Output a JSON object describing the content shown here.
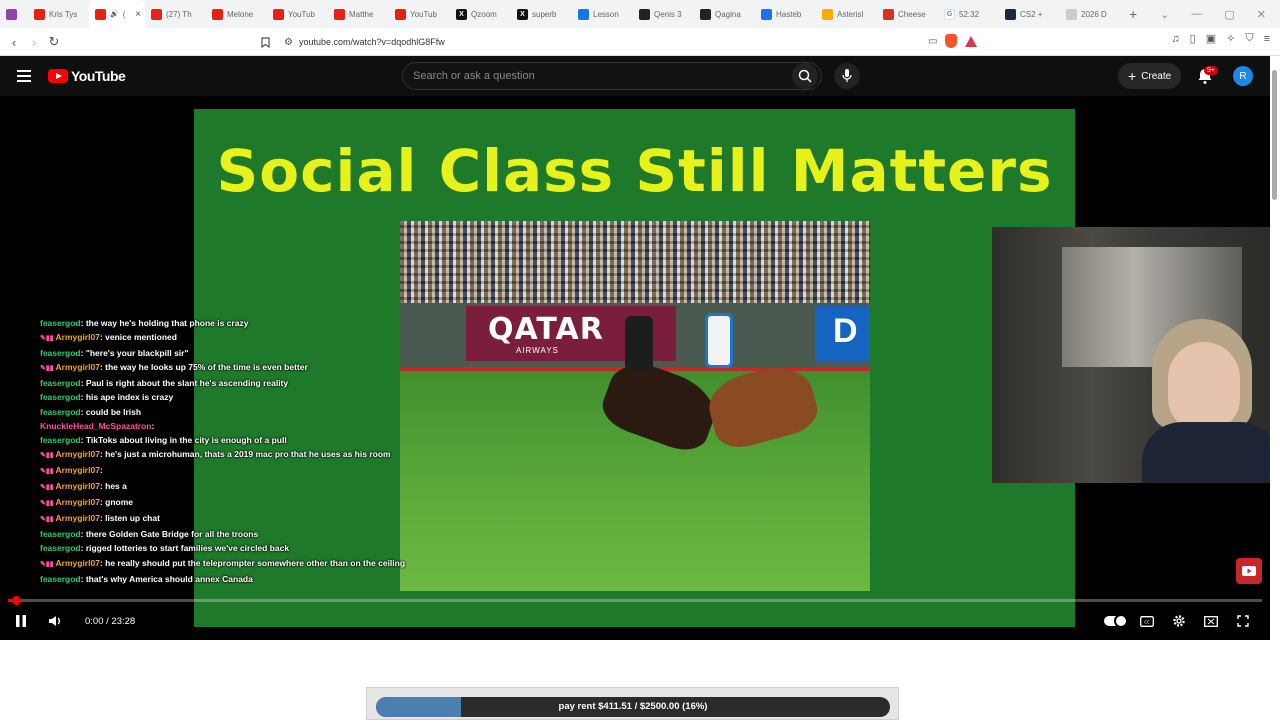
{
  "browser": {
    "tabs": [
      {
        "title": "Kris Tys",
        "icon": "yt"
      },
      {
        "title": "(",
        "icon": "yt",
        "active": true
      },
      {
        "title": "(27) Th",
        "icon": "yt"
      },
      {
        "title": "Melone",
        "icon": "yt"
      },
      {
        "title": "YouTub",
        "icon": "yt"
      },
      {
        "title": "Matthe",
        "icon": "yt"
      },
      {
        "title": "YouTub",
        "icon": "yt"
      },
      {
        "title": "Qzoom",
        "icon": "x"
      },
      {
        "title": "superb",
        "icon": "x"
      },
      {
        "title": "Lesson",
        "icon": "doc"
      },
      {
        "title": "Qenis 3",
        "icon": "quora"
      },
      {
        "title": "Qagina",
        "icon": "quora"
      },
      {
        "title": "Hasteb",
        "icon": "doc"
      },
      {
        "title": "Asterisl",
        "icon": "star"
      },
      {
        "title": "Cheese",
        "icon": "cheese"
      },
      {
        "title": "52:32",
        "icon": "g"
      },
      {
        "title": "CS2 +",
        "icon": "steam"
      },
      {
        "title": "2026 D",
        "icon": "grey"
      }
    ],
    "url": "youtube.com/watch?v=dqodhlG8Ffw"
  },
  "youtube": {
    "logo_text": "YouTube",
    "search_placeholder": "Search or ask a question",
    "create_label": "Create",
    "notif_badge": "9+",
    "avatar_letter": "R"
  },
  "slide": {
    "title": "Social Class Still Matters",
    "qatar_text": "QATAR",
    "qatar_sub": "AIRWAYS",
    "dx_text": "D"
  },
  "chat": [
    {
      "user": "feasergod",
      "color": "green",
      "badges": false,
      "text": ": the way he's holding that phone is crazy"
    },
    {
      "user": "Armygirl07",
      "color": "orange",
      "badges": true,
      "text": ": venice mentioned"
    },
    {
      "user": "feasergod",
      "color": "green",
      "badges": false,
      "text": ": \"here's your blackpill sir\""
    },
    {
      "user": "Armygirl07",
      "color": "orange",
      "badges": true,
      "text": ": the way he looks up 75% of the time is even better"
    },
    {
      "user": "feasergod",
      "color": "green",
      "badges": false,
      "text": ": Paul is right about the slant he's ascending reality"
    },
    {
      "user": "feasergod",
      "color": "green",
      "badges": false,
      "text": ": his ape index is crazy"
    },
    {
      "user": "feasergod",
      "color": "green",
      "badges": false,
      "text": ": could be Irish"
    },
    {
      "user": "KnuckleHead_McSpazatron",
      "color": "pink",
      "badges": false,
      "text": ":"
    },
    {
      "user": "feasergod",
      "color": "green",
      "badges": false,
      "text": ": TikToks about living in the city is enough of a pull"
    },
    {
      "user": "Armygirl07",
      "color": "orange",
      "badges": true,
      "text": ": he's just a microhuman, thats a 2019 mac pro that he uses as his room"
    },
    {
      "user": "Armygirl07",
      "color": "orange",
      "badges": true,
      "text": ":"
    },
    {
      "user": "Armygirl07",
      "color": "orange",
      "badges": true,
      "text": ": hes a"
    },
    {
      "user": "Armygirl07",
      "color": "orange",
      "badges": true,
      "text": ": gnome"
    },
    {
      "user": "Armygirl07",
      "color": "orange",
      "badges": true,
      "text": ": listen up chat"
    },
    {
      "user": "feasergod",
      "color": "green",
      "badges": false,
      "text": ": there Golden Gate Bridge for all the troons"
    },
    {
      "user": "feasergod",
      "color": "green",
      "badges": false,
      "text": ": rigged lotteries to start families we've circled back"
    },
    {
      "user": "Armygirl07",
      "color": "orange",
      "badges": true,
      "text": ": he really should put the teleprompter somewhere other than on the ceiling"
    },
    {
      "user": "feasergod",
      "color": "green",
      "badges": false,
      "text": ": that's why America should annex Canada"
    }
  ],
  "player": {
    "time": "0:00 / 23:28",
    "progress_fraction": 0.0
  },
  "rent": {
    "text": "pay rent $411.51 / $2500.00 (16%)",
    "fraction": 0.1646
  }
}
